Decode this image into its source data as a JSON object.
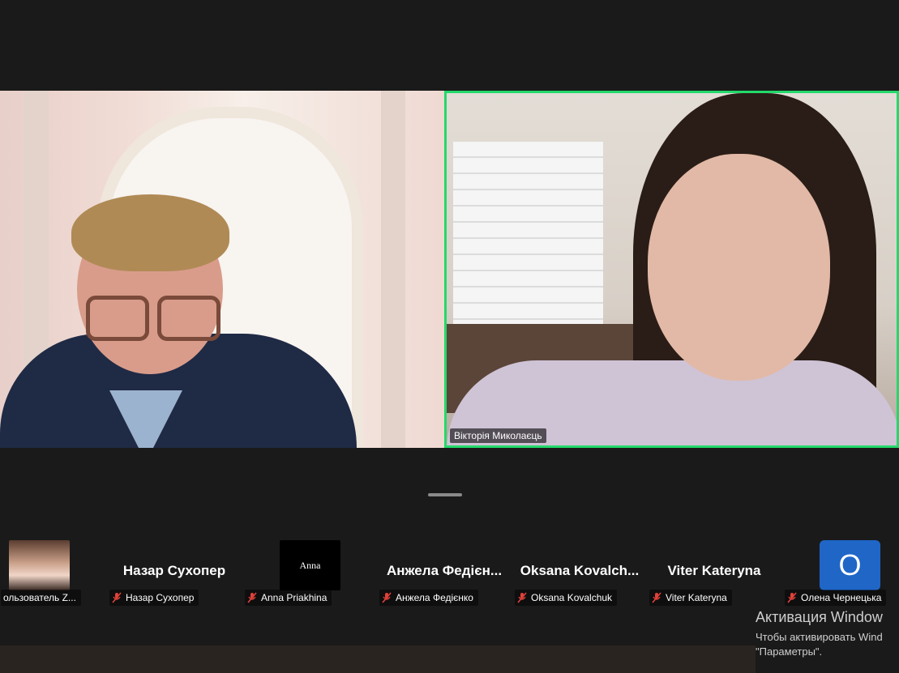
{
  "main_video": {
    "right_name": "Вікторія Миколаєць"
  },
  "gallery": {
    "participants": [
      {
        "display": "",
        "tag": "ользователь Z..."
      },
      {
        "display": "Назар Сухопер",
        "tag": "Назар Сухопер"
      },
      {
        "display": "Anna",
        "tag": "Anna Priakhina"
      },
      {
        "display": "Анжела Федієн...",
        "tag": "Анжела Федієнко"
      },
      {
        "display": "Oksana Kovalch...",
        "tag": "Oksana Kovalchuk"
      },
      {
        "display": "Viter Kateryna",
        "tag": "Viter Kateryna"
      },
      {
        "display": "О",
        "tag": "Олена Чернецька"
      }
    ]
  },
  "windows_activation": {
    "title": "Активация Window",
    "line1": "Чтобы активировать Wind",
    "line2": "\"Параметры\"."
  },
  "colors": {
    "active_speaker_border": "#23d96a",
    "avatar_blue": "#1f66c7",
    "mic_muted": "#e0413a"
  }
}
